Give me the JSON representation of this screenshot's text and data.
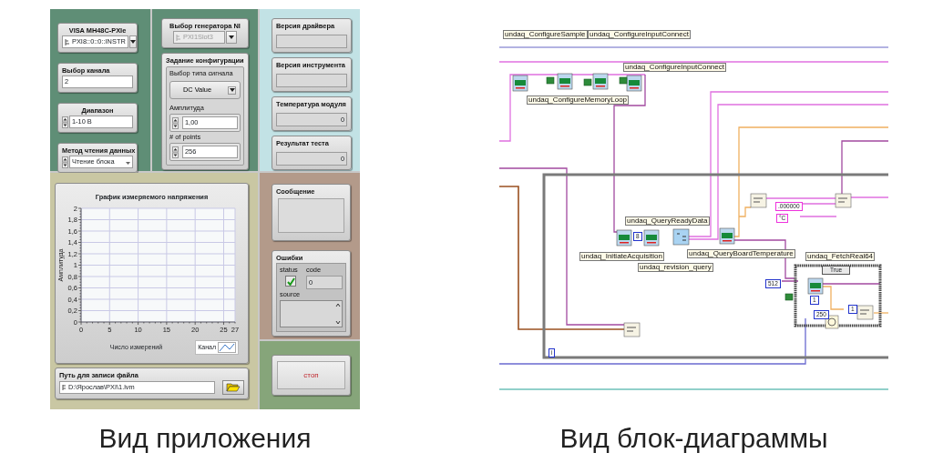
{
  "front_panel": {
    "column_1": [
      {
        "kind": "dropdown",
        "label": "VISA МН48С-PXIe",
        "value": "PXI8::0::0::INSTR"
      },
      {
        "kind": "numeric",
        "label": "Выбор канала",
        "value": "2"
      },
      {
        "kind": "spin",
        "label": "Диапазон",
        "value": "1-10 В"
      },
      {
        "kind": "ring",
        "label": "Метод чтения данных",
        "value": "Чтение блока"
      }
    ],
    "generator": {
      "label": "Выбор генератора NI",
      "value": "PXI1Slot3",
      "disabled": true
    },
    "config": {
      "title": "Задание конфигурации",
      "signal_type": {
        "label": "Выбор типа сигнала",
        "value": "DC Value"
      },
      "amplitude": {
        "label": "Амплитуда",
        "value": "1,00"
      },
      "points": {
        "label": "# of points",
        "value": "256"
      }
    },
    "indicators": [
      {
        "label": "Версия драйвера"
      },
      {
        "label": "Версия инструмента"
      },
      {
        "label": "Температура модуля",
        "value": "0"
      },
      {
        "label": "Результат теста",
        "value": "0"
      }
    ],
    "graph": {
      "title": "График измеряемого напряжения",
      "chart_data": {
        "type": "line",
        "xlabel": "Число измерений",
        "ylabel": "Амплитуда",
        "categories": [
          "0",
          "5",
          "10",
          "15",
          "20",
          "25",
          "27"
        ],
        "ylim": [
          0,
          2
        ],
        "grid": true,
        "yticks": [
          {
            "value": 0,
            "label": "0"
          },
          {
            "value": 0.2,
            "label": "0,2"
          },
          {
            "value": 0.4,
            "label": "0,4"
          },
          {
            "value": 0.6,
            "label": "0,6"
          },
          {
            "value": 0.8,
            "label": "0,8"
          },
          {
            "value": 1,
            "label": "1"
          },
          {
            "value": 1.2,
            "label": "1,2"
          },
          {
            "value": 1.4,
            "label": "1,4"
          },
          {
            "value": 1.6,
            "label": "1,6"
          },
          {
            "value": 1.8,
            "label": "1,8"
          },
          {
            "value": 2,
            "label": "2"
          }
        ],
        "series": [
          {
            "name": "Канал",
            "color": "#3a78c8",
            "values": [
              null,
              null,
              null,
              null,
              null,
              null,
              null
            ]
          }
        ]
      }
    },
    "file_path": {
      "label": "Путь для записи файла",
      "value": "D:\\Ярослав\\PXI\\1.lvm"
    },
    "message": {
      "label": "Сообщение"
    },
    "errors": {
      "label": "Ошибки",
      "status_label": "status",
      "status": true,
      "code_label": "code",
      "code": "0",
      "source_label": "source"
    },
    "stop_button": {
      "label": "стоп"
    }
  },
  "block_diagram": {
    "labels": [
      "undaq_ConfigureSample",
      "undaq_ConfigureInputConnect",
      "undaq_ConfigureInputConnect",
      "undaq_ConfigureMemoryLoop",
      "undaq_QueryReadyData",
      "undaq_InitiateAcquisition",
      "undaq_revision_query",
      "undaq_QueryBoardTemperature",
      "undaq_FetchReal64"
    ],
    "constants": [
      {
        "text": "8",
        "kind": "numeric"
      },
      {
        "text": ".000000",
        "kind": "string"
      },
      {
        "text": "°C",
        "kind": "string"
      },
      {
        "text": "512",
        "kind": "numeric"
      },
      {
        "text": "1",
        "kind": "numeric"
      },
      {
        "text": "250",
        "kind": "numeric"
      },
      {
        "text": "1",
        "kind": "numeric"
      },
      {
        "text": "i",
        "kind": "index"
      }
    ],
    "case_selector": "True"
  },
  "captions": [
    "Вид приложения",
    "Вид блок-диаграммы"
  ]
}
